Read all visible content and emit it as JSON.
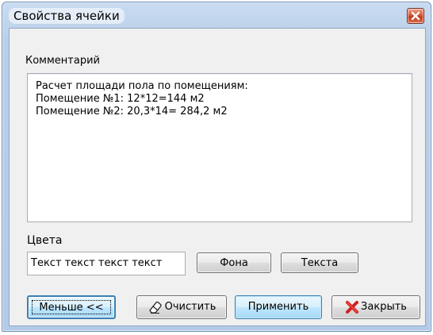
{
  "window": {
    "title": "Свойства ячейки"
  },
  "comment": {
    "label": "Комментарий",
    "lines": [
      "Расчет площади пола по помещениям:",
      "Помещение №1: 12*12=144 м2",
      "Помещение №2: 20,3*14= 284,2 м2"
    ]
  },
  "colors": {
    "label": "Цвета",
    "sample_text": "Текст текст текст текст",
    "background_button": "Фона",
    "text_button": "Текста"
  },
  "buttons": {
    "less": "Меньше <<",
    "clear": "Очистить",
    "apply": "Применить",
    "close": "Закрыть"
  },
  "icons": {
    "close_window": "close-x-icon",
    "clear": "eraser-icon",
    "close": "red-x-icon"
  },
  "theme": {
    "close_red": "#c23b1c",
    "x_icon_red": "#d21f1f",
    "focus_blue": "#3c7fb1"
  }
}
